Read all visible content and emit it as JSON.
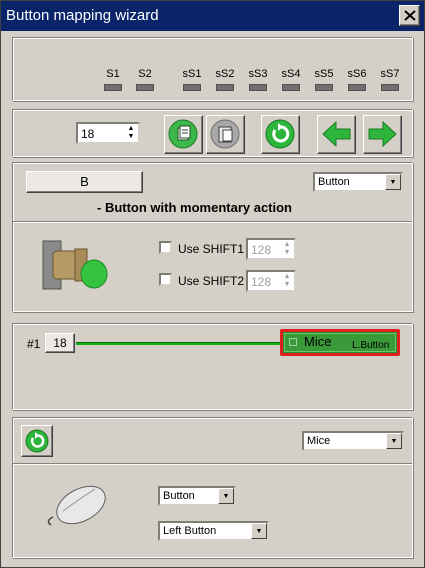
{
  "window": {
    "title": "Button mapping wizard"
  },
  "shift_indicators": {
    "labels": [
      "S1",
      "S2",
      "sS1",
      "sS2",
      "sS3",
      "sS4",
      "sS5",
      "sS6",
      "sS7"
    ]
  },
  "toolbar": {
    "spin_value": "18"
  },
  "button_config": {
    "button_label": "B",
    "type_select": "Button",
    "description": "- Button with momentary action",
    "shift1": {
      "label": "Use SHIFT1",
      "value": "128"
    },
    "shift2": {
      "label": "Use SHIFT2",
      "value": "128"
    }
  },
  "mapping": {
    "index": "#1",
    "button_number": "18",
    "target": {
      "name": "Mice",
      "action": "L.Button"
    },
    "colors": {
      "line": "#10b010",
      "target_border": "#e02020",
      "target_bg": "#2a8a2a"
    }
  },
  "target_config": {
    "device_select": "Mice",
    "action_type_select": "Button",
    "action_select": "Left Button"
  }
}
